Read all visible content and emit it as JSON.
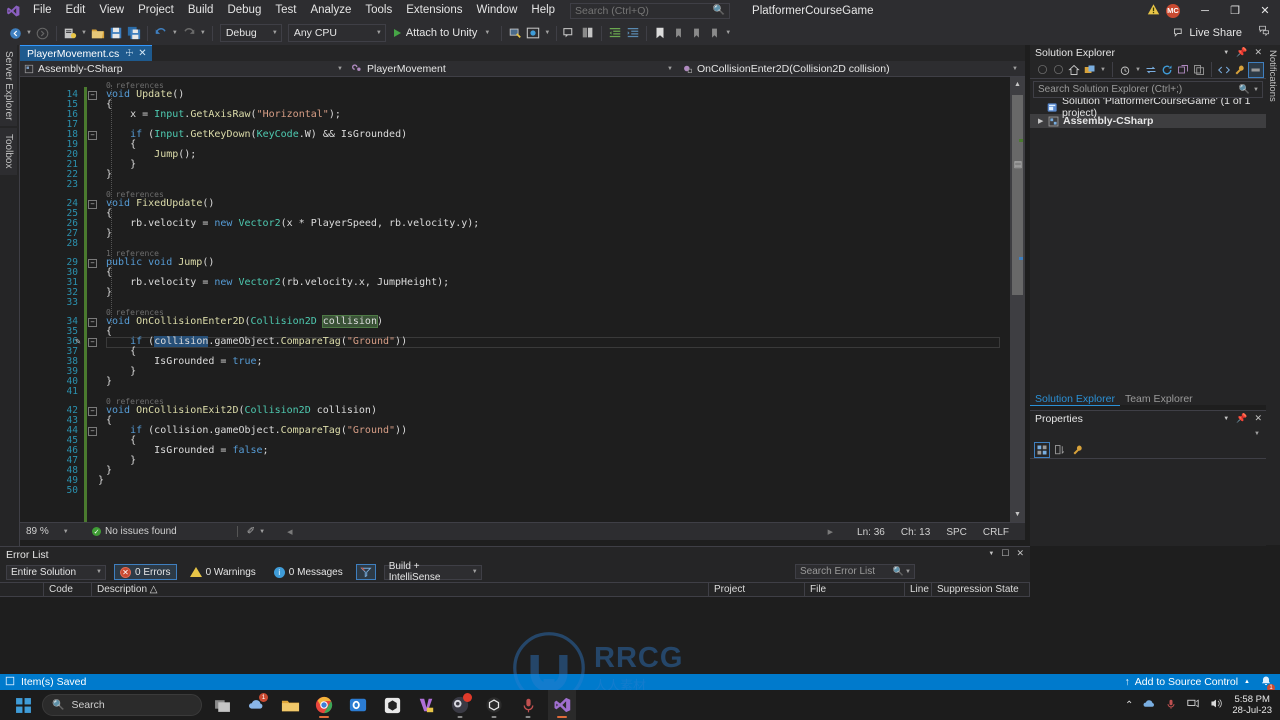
{
  "titlebar": {
    "logo_icon": "visual-studio-logo",
    "menus": [
      "File",
      "Edit",
      "View",
      "Project",
      "Build",
      "Debug",
      "Test",
      "Analyze",
      "Tools",
      "Extensions",
      "Window",
      "Help"
    ],
    "search_placeholder": "Search (Ctrl+Q)",
    "solution_name": "PlatformerCourseGame",
    "account_initials": "MC",
    "window_minimize": "─",
    "window_restore": "❐",
    "window_close": "✕"
  },
  "toolbar": {
    "config_value": "Debug",
    "platform_value": "Any CPU",
    "run_label": "Attach to Unity",
    "live_share_label": "Live Share"
  },
  "left_tabs": [
    "Server Explorer",
    "Toolbox"
  ],
  "right_tabs": [
    "Notifications"
  ],
  "editor": {
    "tab_label": "PlayerMovement.cs",
    "tab_pin": "☩",
    "tab_close": "✕",
    "nav_project": "Assembly-CSharp",
    "nav_type": "PlayerMovement",
    "nav_member": "OnCollisionEnter2D(Collision2D collision)",
    "lines": [
      {
        "n": "",
        "ref": "0 references",
        "indent": 0
      },
      {
        "n": "14",
        "fold": "minus",
        "tokens": [
          {
            "t": "void ",
            "c": "kw"
          },
          {
            "t": "Update",
            "c": "fn"
          },
          {
            "t": "()",
            "c": "id"
          }
        ]
      },
      {
        "n": "15",
        "tokens": [
          {
            "t": "{",
            "c": "id"
          }
        ]
      },
      {
        "n": "16",
        "tokens": [
          {
            "t": "    x = ",
            "c": "id"
          },
          {
            "t": "Input",
            "c": "typ"
          },
          {
            "t": ".",
            "c": "id"
          },
          {
            "t": "GetAxisRaw",
            "c": "fn"
          },
          {
            "t": "(",
            "c": "id"
          },
          {
            "t": "\"Horizontal\"",
            "c": "str"
          },
          {
            "t": ");",
            "c": "id"
          }
        ]
      },
      {
        "n": "17",
        "tokens": []
      },
      {
        "n": "18",
        "fold": "minus",
        "tokens": [
          {
            "t": "    ",
            "c": "id"
          },
          {
            "t": "if",
            "c": "kw"
          },
          {
            "t": " (",
            "c": "id"
          },
          {
            "t": "Input",
            "c": "typ"
          },
          {
            "t": ".",
            "c": "id"
          },
          {
            "t": "GetKeyDown",
            "c": "fn"
          },
          {
            "t": "(",
            "c": "id"
          },
          {
            "t": "KeyCode",
            "c": "typ"
          },
          {
            "t": ".W) && IsGrounded)",
            "c": "id"
          }
        ]
      },
      {
        "n": "19",
        "tokens": [
          {
            "t": "    {",
            "c": "id"
          }
        ]
      },
      {
        "n": "20",
        "tokens": [
          {
            "t": "        ",
            "c": "id"
          },
          {
            "t": "Jump",
            "c": "fn"
          },
          {
            "t": "();",
            "c": "id"
          }
        ]
      },
      {
        "n": "21",
        "tokens": [
          {
            "t": "    }",
            "c": "id"
          }
        ]
      },
      {
        "n": "22",
        "tokens": [
          {
            "t": "}",
            "c": "id"
          }
        ]
      },
      {
        "n": "23",
        "tokens": []
      },
      {
        "n": "",
        "ref": "0 references"
      },
      {
        "n": "24",
        "fold": "minus",
        "tokens": [
          {
            "t": "void ",
            "c": "kw"
          },
          {
            "t": "FixedUpdate",
            "c": "fn"
          },
          {
            "t": "()",
            "c": "id"
          }
        ]
      },
      {
        "n": "25",
        "tokens": [
          {
            "t": "{",
            "c": "id"
          }
        ]
      },
      {
        "n": "26",
        "tokens": [
          {
            "t": "    rb.velocity = ",
            "c": "id"
          },
          {
            "t": "new ",
            "c": "kw"
          },
          {
            "t": "Vector2",
            "c": "typ"
          },
          {
            "t": "(x * PlayerSpeed, rb.velocity.y);",
            "c": "id"
          }
        ]
      },
      {
        "n": "27",
        "tokens": [
          {
            "t": "}",
            "c": "id"
          }
        ]
      },
      {
        "n": "28",
        "tokens": []
      },
      {
        "n": "",
        "ref": "1 reference"
      },
      {
        "n": "29",
        "fold": "minus",
        "tokens": [
          {
            "t": "public void ",
            "c": "kw"
          },
          {
            "t": "Jump",
            "c": "fn"
          },
          {
            "t": "()",
            "c": "id"
          }
        ]
      },
      {
        "n": "30",
        "tokens": [
          {
            "t": "{",
            "c": "id"
          }
        ]
      },
      {
        "n": "31",
        "tokens": [
          {
            "t": "    rb.velocity = ",
            "c": "id"
          },
          {
            "t": "new ",
            "c": "kw"
          },
          {
            "t": "Vector2",
            "c": "typ"
          },
          {
            "t": "(rb.velocity.x, JumpHeight);",
            "c": "id"
          }
        ]
      },
      {
        "n": "32",
        "tokens": [
          {
            "t": "}",
            "c": "id"
          }
        ]
      },
      {
        "n": "33",
        "tokens": []
      },
      {
        "n": "",
        "ref": "0 references"
      },
      {
        "n": "34",
        "fold": "minus",
        "tokens": [
          {
            "t": "void ",
            "c": "kw"
          },
          {
            "t": "OnCollisionEnter2D",
            "c": "fn"
          },
          {
            "t": "(",
            "c": "id"
          },
          {
            "t": "Collision2D",
            "c": "typ"
          },
          {
            "t": " ",
            "c": "id"
          },
          {
            "t": "collision",
            "c": "id hl-green"
          },
          {
            "t": ")",
            "c": "id"
          }
        ]
      },
      {
        "n": "35",
        "tokens": [
          {
            "t": "{",
            "c": "id"
          }
        ]
      },
      {
        "n": "36",
        "glyph": "pencil",
        "fold": "minus",
        "current": true,
        "tokens": [
          {
            "t": "    ",
            "c": "id"
          },
          {
            "t": "if",
            "c": "kw"
          },
          {
            "t": " (",
            "c": "id"
          },
          {
            "t": "collision",
            "c": "id hl-blue"
          },
          {
            "t": ".gameObject.",
            "c": "id"
          },
          {
            "t": "CompareTag",
            "c": "fn"
          },
          {
            "t": "(",
            "c": "id"
          },
          {
            "t": "\"Ground\"",
            "c": "str"
          },
          {
            "t": "))",
            "c": "id"
          }
        ]
      },
      {
        "n": "37",
        "tokens": [
          {
            "t": "    {",
            "c": "id"
          }
        ]
      },
      {
        "n": "38",
        "tokens": [
          {
            "t": "        IsGrounded = ",
            "c": "id"
          },
          {
            "t": "true",
            "c": "kw"
          },
          {
            "t": ";",
            "c": "id"
          }
        ]
      },
      {
        "n": "39",
        "tokens": [
          {
            "t": "    }",
            "c": "id"
          }
        ]
      },
      {
        "n": "40",
        "tokens": [
          {
            "t": "}",
            "c": "id"
          }
        ]
      },
      {
        "n": "41",
        "tokens": []
      },
      {
        "n": "",
        "ref": "0 references"
      },
      {
        "n": "42",
        "fold": "minus",
        "tokens": [
          {
            "t": "void ",
            "c": "kw"
          },
          {
            "t": "OnCollisionExit2D",
            "c": "fn"
          },
          {
            "t": "(",
            "c": "id"
          },
          {
            "t": "Collision2D",
            "c": "typ"
          },
          {
            "t": " collision)",
            "c": "id"
          }
        ]
      },
      {
        "n": "43",
        "tokens": [
          {
            "t": "{",
            "c": "id"
          }
        ]
      },
      {
        "n": "44",
        "fold": "minus",
        "tokens": [
          {
            "t": "    ",
            "c": "id"
          },
          {
            "t": "if",
            "c": "kw"
          },
          {
            "t": " (collision.gameObject.",
            "c": "id"
          },
          {
            "t": "CompareTag",
            "c": "fn"
          },
          {
            "t": "(",
            "c": "id"
          },
          {
            "t": "\"Ground\"",
            "c": "str"
          },
          {
            "t": "))",
            "c": "id"
          }
        ]
      },
      {
        "n": "45",
        "tokens": [
          {
            "t": "    {",
            "c": "id"
          }
        ]
      },
      {
        "n": "46",
        "tokens": [
          {
            "t": "        IsGrounded = ",
            "c": "id"
          },
          {
            "t": "false",
            "c": "kw"
          },
          {
            "t": ";",
            "c": "id"
          }
        ]
      },
      {
        "n": "47",
        "tokens": [
          {
            "t": "    }",
            "c": "id"
          }
        ]
      },
      {
        "n": "48",
        "tokens": [
          {
            "t": "}",
            "c": "id"
          }
        ]
      },
      {
        "n": "49",
        "tokens": [
          {
            "t": "}",
            "c": "id"
          }
        ],
        "closebrace": true
      },
      {
        "n": "50",
        "tokens": []
      }
    ]
  },
  "editor_status": {
    "zoom": "89 %",
    "issues": "No issues found",
    "line": "Ln: 36",
    "col": "Ch: 13",
    "spaces": "SPC",
    "eol": "CRLF"
  },
  "error_list": {
    "title": "Error List",
    "scope": "Entire Solution",
    "errors": "0 Errors",
    "warnings": "0 Warnings",
    "messages": "0 Messages",
    "build_filter": "Build + IntelliSense",
    "search_placeholder": "Search Error List",
    "columns": [
      "",
      "Code",
      "Description △",
      "Project",
      "File",
      "Line",
      "Suppression State"
    ],
    "rows": []
  },
  "solution_explorer": {
    "title": "Solution Explorer",
    "search_placeholder": "Search Solution Explorer (Ctrl+;)",
    "items": [
      {
        "label": "Solution 'PlatformerCourseGame' (1 of 1 project)",
        "icon": "solution-icon",
        "expander": "",
        "bold": false,
        "selected": false
      },
      {
        "label": "Assembly-CSharp",
        "icon": "project-icon",
        "expander": "▶",
        "bold": true,
        "selected": true
      }
    ],
    "tabs": [
      "Solution Explorer",
      "Team Explorer"
    ]
  },
  "properties": {
    "title": "Properties"
  },
  "vs_status": {
    "saved_text": "Item(s) Saved",
    "source_control": "Add to Source Control",
    "notification_count": "1"
  },
  "taskbar": {
    "search_placeholder": "Search",
    "apps": [
      {
        "name": "task-view-icon",
        "badge": "",
        "running": false
      },
      {
        "name": "onedrive-icon",
        "badge": "1",
        "running": false
      },
      {
        "name": "file-explorer-icon",
        "badge": "",
        "running": false
      },
      {
        "name": "chrome-icon",
        "badge": "",
        "running": true
      },
      {
        "name": "outlook-icon",
        "badge": "",
        "running": false
      },
      {
        "name": "unity-hub-icon",
        "badge": "",
        "running": false
      },
      {
        "name": "visual-paradigm-icon",
        "badge": "",
        "running": false
      },
      {
        "name": "obs-icon",
        "badge": "●",
        "running": true
      },
      {
        "name": "unity-editor-icon",
        "badge": "",
        "running": true
      },
      {
        "name": "audacity-icon",
        "badge": "",
        "running": true
      },
      {
        "name": "visual-studio-icon",
        "badge": "",
        "running": true
      }
    ],
    "clock_time": "5:58 PM",
    "clock_date": "28-Jul-23"
  },
  "watermark": {
    "main": "RRCG",
    "sub": "人人素材",
    "overlay": "Udemy"
  },
  "colors": {
    "accent": "#007acc",
    "titlebar_bg": "#2d2d30",
    "editor_bg": "#1e1e1e",
    "panel_bg": "#252526"
  }
}
